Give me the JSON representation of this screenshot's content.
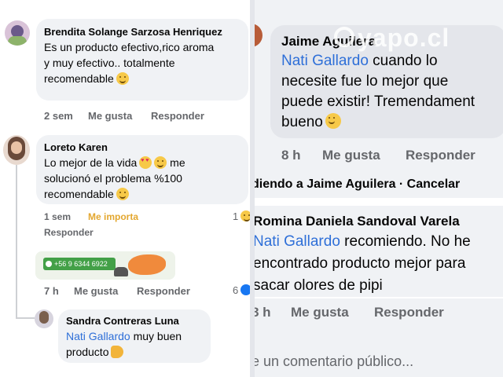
{
  "left": {
    "comments": [
      {
        "author": "Brendita Solange Sarzosa Henriquez",
        "lines": [
          "Es un producto efectivo,rico aroma",
          "y muy efectivo.. totalmente",
          "recomendable"
        ],
        "time": "2 sem",
        "like": "Me gusta",
        "reply": "Responder"
      },
      {
        "author": "Loreto Karen",
        "lines": [
          "Lo mejor de la vida",
          "solucionó el problema %100",
          "recomendable"
        ],
        "time": "1 sem",
        "like": "Me importa",
        "reply": "Responder",
        "reaction_count": "1"
      },
      {
        "time": "7 h",
        "like": "Me gusta",
        "reply": "Responder",
        "reaction_count": "6",
        "ad_phone": "+56 9 6344 6922"
      },
      {
        "author": "Sandra Contreras Luna",
        "mention": "Nati Gallardo",
        "text": " muy buen",
        "text2": "producto"
      }
    ]
  },
  "right": {
    "watermark": "yapo.cl",
    "comments": [
      {
        "author": "Jaime Aguilera",
        "mention": "Nati Gallardo",
        "text": " cuando lo",
        "lines": [
          "necesite fue lo mejor que",
          "puede existir! Tremendament",
          "bueno"
        ],
        "time": "8 h",
        "like": "Me gusta",
        "reply": "Responder"
      },
      {
        "replying_to": "diendo a Jaime Aguilera · Cancelar"
      },
      {
        "author": "Romina Daniela Sandoval Varela",
        "mention": "Nati Gallardo",
        "text": "  recomiendo. No he",
        "lines": [
          "encontrado producto mejor para",
          "sacar olores de pipi"
        ],
        "time": "8 h",
        "like": "Me gusta",
        "reply": "Responder"
      }
    ],
    "composer_placeholder": "e un comentario público..."
  }
}
